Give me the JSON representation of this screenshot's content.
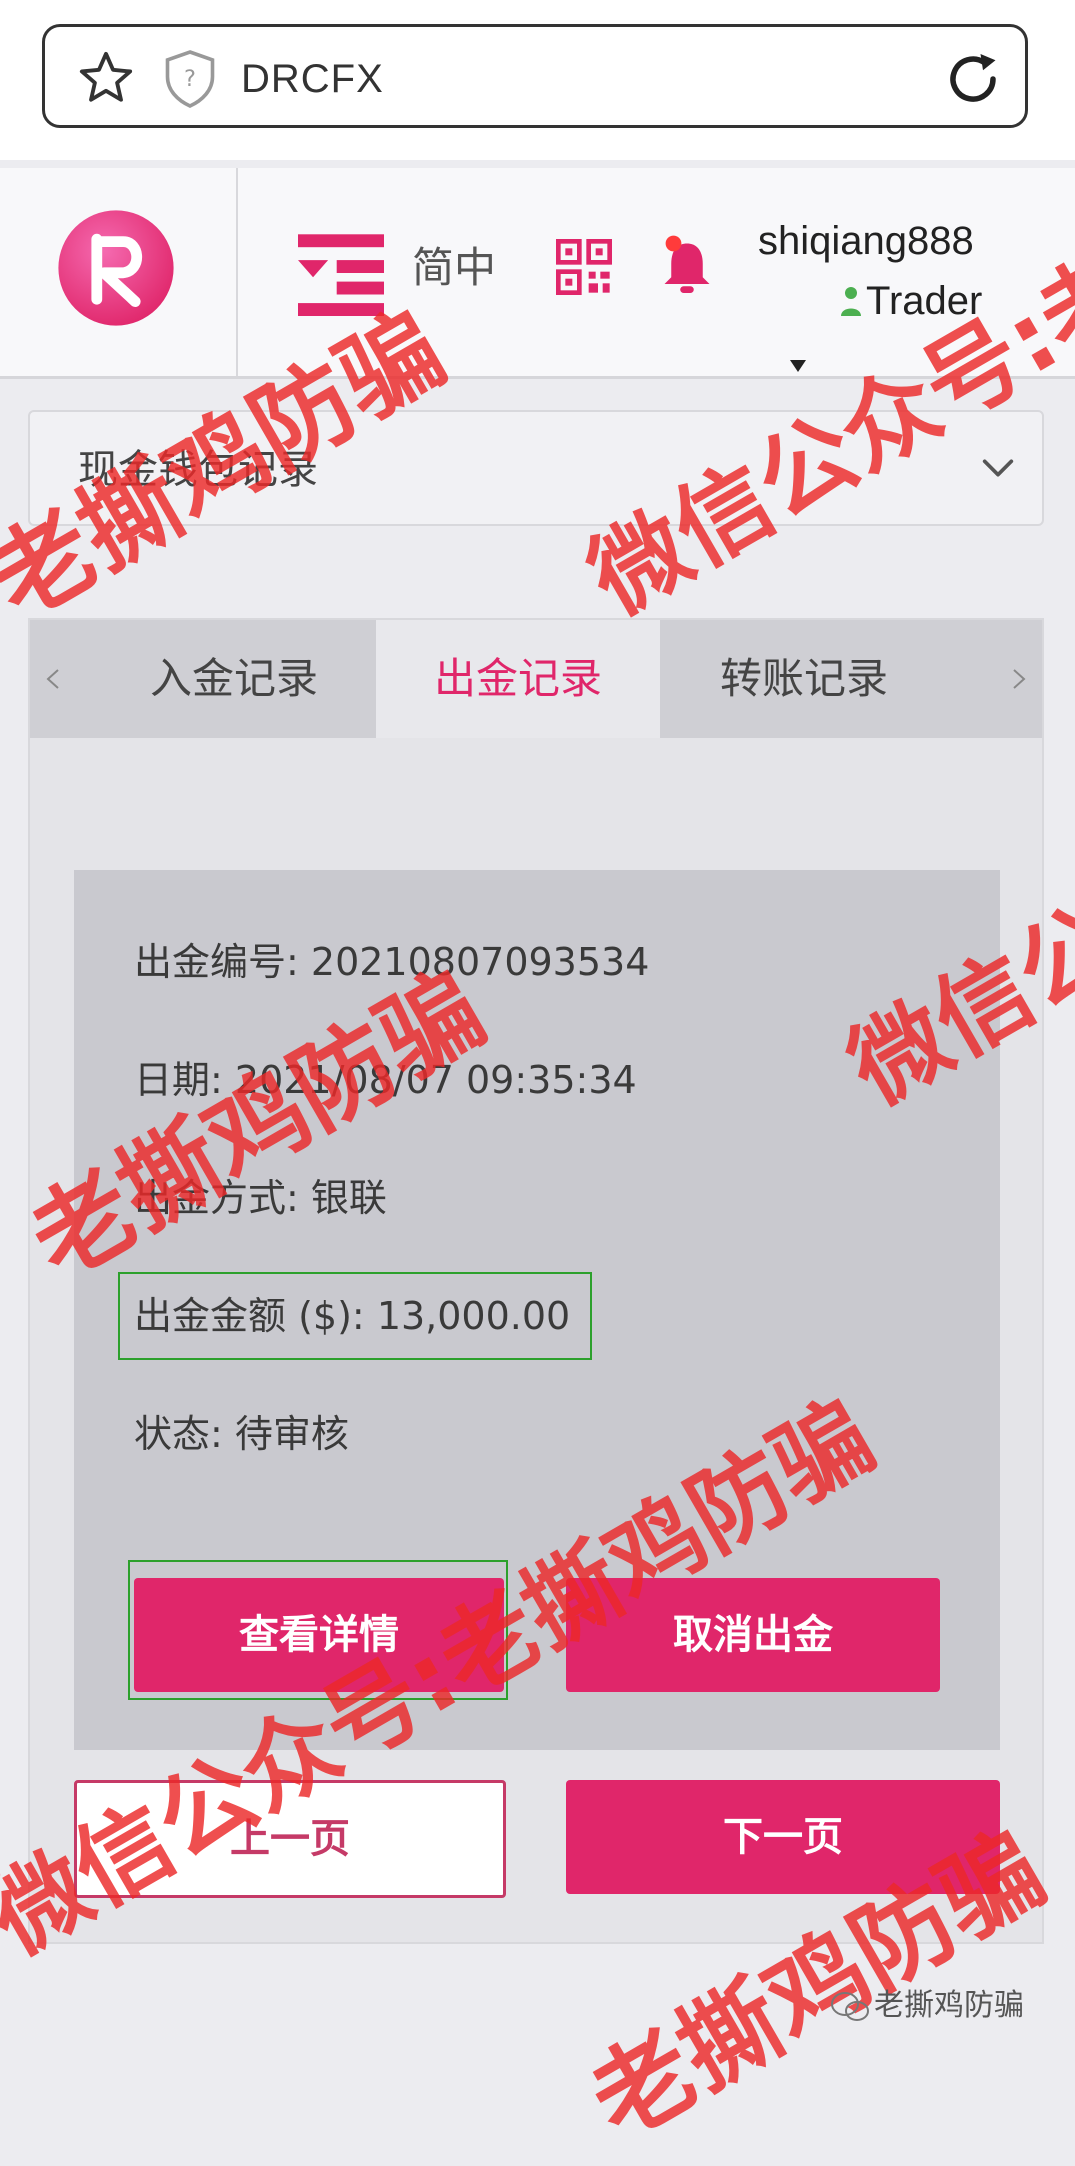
{
  "browser": {
    "url": "DRCFX"
  },
  "header": {
    "language": "简中",
    "username": "shiqiang888",
    "role": "Trader"
  },
  "wallet_select": {
    "value": "现金钱包记录"
  },
  "tabs": [
    {
      "label": "入金记录",
      "active": false
    },
    {
      "label": "出金记录",
      "active": true
    },
    {
      "label": "转账记录",
      "active": false
    }
  ],
  "record": {
    "id_label": "出金编号:",
    "id_value": "20210807093534",
    "date_label": "日期:",
    "date_value": "2021/08/07 09:35:34",
    "method_label": "出金方式:",
    "method_value": "银联",
    "amount_label": "出金金额 ($):",
    "amount_value": "13,000.00",
    "status_label": "状态:",
    "status_value": "待审核"
  },
  "buttons": {
    "details": "查看详情",
    "cancel": "取消出金",
    "prev_page": "上一页",
    "next_page": "下一页"
  },
  "watermarks": {
    "brand": "老撕鸡防骗",
    "wechat": "微信公众号:老撕鸡防骗"
  },
  "colors": {
    "accent": "#e0266a",
    "highlight_box": "#2ca02c",
    "watermark": "#e82828"
  }
}
